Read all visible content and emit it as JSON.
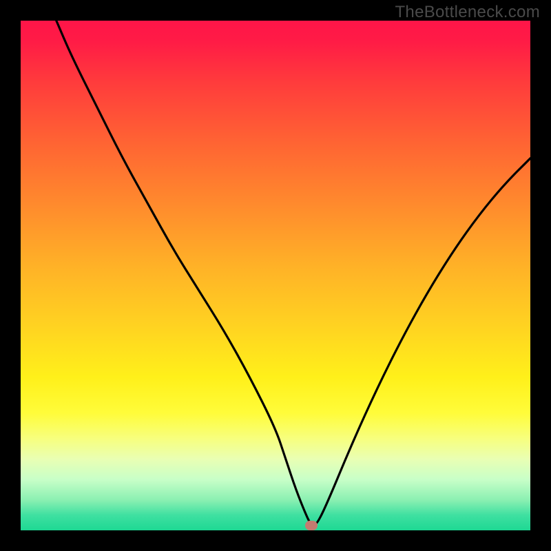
{
  "watermark": "TheBottleneck.com",
  "chart_data": {
    "type": "line",
    "title": "",
    "xlabel": "",
    "ylabel": "",
    "xlim": [
      0,
      100
    ],
    "ylim": [
      0,
      100
    ],
    "grid": false,
    "legend": false,
    "background": "red-yellow-green-vertical-gradient",
    "series": [
      {
        "name": "curve",
        "x": [
          7,
          10,
          15,
          20,
          25,
          30,
          35,
          40,
          45,
          50,
          52,
          54,
          56,
          57,
          58,
          60,
          65,
          70,
          75,
          80,
          85,
          90,
          95,
          100
        ],
        "y": [
          100,
          93,
          83,
          73,
          64,
          55,
          47,
          39,
          30,
          20,
          14,
          8,
          3,
          1,
          1,
          5,
          17,
          28,
          38,
          47,
          55,
          62,
          68,
          73
        ]
      }
    ],
    "marker": {
      "x": 57,
      "y": 1,
      "color": "#c47b70"
    }
  }
}
